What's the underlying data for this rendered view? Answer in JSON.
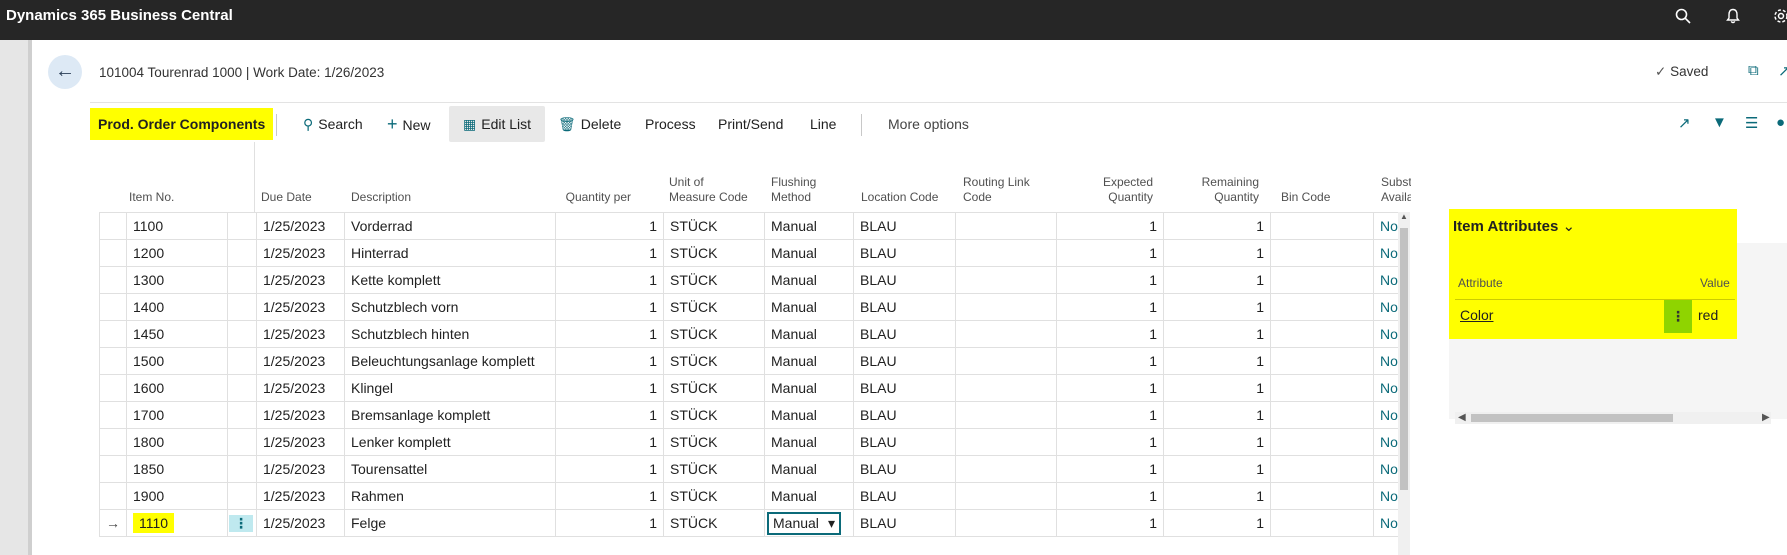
{
  "app": {
    "title": "Dynamics 365 Business Central",
    "icons": [
      "search-icon",
      "bell-icon",
      "gear-icon"
    ]
  },
  "header": {
    "breadcrumb": "101004 Tourenrad 1000 | Work Date: 1/26/2023",
    "saved_label": "Saved"
  },
  "actions": {
    "page_caption": "Prod. Order Components",
    "search": "Search",
    "new": "New",
    "edit_list": "Edit List",
    "delete": "Delete",
    "process": "Process",
    "print_send": "Print/Send",
    "line": "Line",
    "more_options": "More options"
  },
  "columns": {
    "item_no": "Item No.",
    "due_date": "Due Date",
    "description": "Description",
    "quantity_per": "Quantity per",
    "uom_1": "Unit of",
    "uom_2": "Measure Code",
    "flushing_1": "Flushing",
    "flushing_2": "Method",
    "location": "Location Code",
    "routing_1": "Routing Link",
    "routing_2": "Code",
    "expected_1": "Expected",
    "expected_2": "Quantity",
    "remaining_1": "Remaining",
    "remaining_2": "Quantity",
    "bin": "Bin Code",
    "subst_1": "Subst",
    "subst_2": "Availa"
  },
  "rows": [
    {
      "item_no": "1100",
      "due_date": "1/25/2023",
      "description": "Vorderrad",
      "qty_per": "1",
      "uom": "STÜCK",
      "flushing": "Manual",
      "location": "BLAU",
      "routing": "",
      "expected": "1",
      "remaining": "1",
      "bin": "",
      "subst": "No"
    },
    {
      "item_no": "1200",
      "due_date": "1/25/2023",
      "description": "Hinterrad",
      "qty_per": "1",
      "uom": "STÜCK",
      "flushing": "Manual",
      "location": "BLAU",
      "routing": "",
      "expected": "1",
      "remaining": "1",
      "bin": "",
      "subst": "No"
    },
    {
      "item_no": "1300",
      "due_date": "1/25/2023",
      "description": "Kette komplett",
      "qty_per": "1",
      "uom": "STÜCK",
      "flushing": "Manual",
      "location": "BLAU",
      "routing": "",
      "expected": "1",
      "remaining": "1",
      "bin": "",
      "subst": "No"
    },
    {
      "item_no": "1400",
      "due_date": "1/25/2023",
      "description": "Schutzblech vorn",
      "qty_per": "1",
      "uom": "STÜCK",
      "flushing": "Manual",
      "location": "BLAU",
      "routing": "",
      "expected": "1",
      "remaining": "1",
      "bin": "",
      "subst": "No"
    },
    {
      "item_no": "1450",
      "due_date": "1/25/2023",
      "description": "Schutzblech hinten",
      "qty_per": "1",
      "uom": "STÜCK",
      "flushing": "Manual",
      "location": "BLAU",
      "routing": "",
      "expected": "1",
      "remaining": "1",
      "bin": "",
      "subst": "No"
    },
    {
      "item_no": "1500",
      "due_date": "1/25/2023",
      "description": "Beleuchtungsanlage komplett",
      "qty_per": "1",
      "uom": "STÜCK",
      "flushing": "Manual",
      "location": "BLAU",
      "routing": "",
      "expected": "1",
      "remaining": "1",
      "bin": "",
      "subst": "No"
    },
    {
      "item_no": "1600",
      "due_date": "1/25/2023",
      "description": "Klingel",
      "qty_per": "1",
      "uom": "STÜCK",
      "flushing": "Manual",
      "location": "BLAU",
      "routing": "",
      "expected": "1",
      "remaining": "1",
      "bin": "",
      "subst": "No"
    },
    {
      "item_no": "1700",
      "due_date": "1/25/2023",
      "description": "Bremsanlage komplett",
      "qty_per": "1",
      "uom": "STÜCK",
      "flushing": "Manual",
      "location": "BLAU",
      "routing": "",
      "expected": "1",
      "remaining": "1",
      "bin": "",
      "subst": "No"
    },
    {
      "item_no": "1800",
      "due_date": "1/25/2023",
      "description": "Lenker komplett",
      "qty_per": "1",
      "uom": "STÜCK",
      "flushing": "Manual",
      "location": "BLAU",
      "routing": "",
      "expected": "1",
      "remaining": "1",
      "bin": "",
      "subst": "No"
    },
    {
      "item_no": "1850",
      "due_date": "1/25/2023",
      "description": "Tourensattel",
      "qty_per": "1",
      "uom": "STÜCK",
      "flushing": "Manual",
      "location": "BLAU",
      "routing": "",
      "expected": "1",
      "remaining": "1",
      "bin": "",
      "subst": "No"
    },
    {
      "item_no": "1900",
      "due_date": "1/25/2023",
      "description": "Rahmen",
      "qty_per": "1",
      "uom": "STÜCK",
      "flushing": "Manual",
      "location": "BLAU",
      "routing": "",
      "expected": "1",
      "remaining": "1",
      "bin": "",
      "subst": "No"
    },
    {
      "item_no": "1110",
      "due_date": "1/25/2023",
      "description": "Felge",
      "qty_per": "1",
      "uom": "STÜCK",
      "flushing": "Manual",
      "location": "BLAU",
      "routing": "",
      "expected": "1",
      "remaining": "1",
      "bin": "",
      "subst": "No",
      "selected": true
    }
  ],
  "factbox": {
    "title": "Item Attributes",
    "col_attribute": "Attribute",
    "col_value": "Value",
    "attribute": "Color",
    "value": "red"
  },
  "colors": {
    "highlight": "#ffff00",
    "accent": "#0b6a79",
    "topbar": "#262626"
  }
}
